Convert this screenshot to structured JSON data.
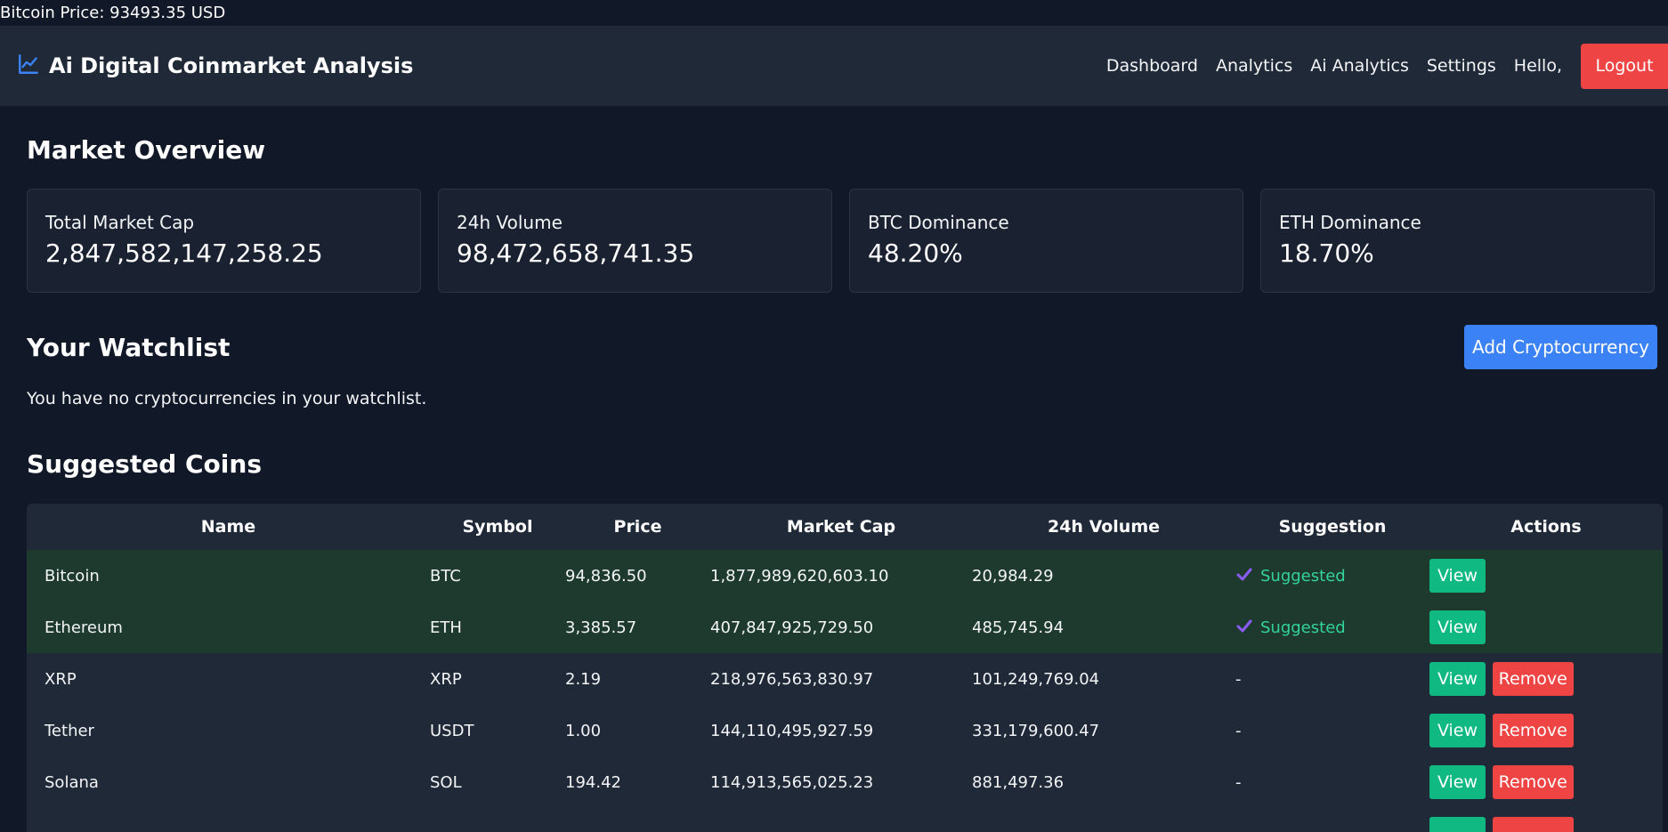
{
  "ticker": "Bitcoin Price: 93493.35 USD",
  "navbar": {
    "brand_icon": "chart-line-icon",
    "brand_title": "Ai Digital Coinmarket Analysis",
    "links": [
      "Dashboard",
      "Analytics",
      "Ai Analytics",
      "Settings"
    ],
    "greeting": "Hello,",
    "logout_label": "Logout"
  },
  "overview": {
    "title": "Market Overview",
    "cards": [
      {
        "label": "Total Market Cap",
        "value": "2,847,582,147,258.25"
      },
      {
        "label": "24h Volume",
        "value": "98,472,658,741.35"
      },
      {
        "label": "BTC Dominance",
        "value": "48.20%"
      },
      {
        "label": "ETH Dominance",
        "value": "18.70%"
      }
    ]
  },
  "watchlist": {
    "title": "Your Watchlist",
    "add_label": "Add Cryptocurrency",
    "empty_message": "You have no cryptocurrencies in your watchlist."
  },
  "suggested": {
    "title": "Suggested Coins",
    "columns": [
      "Name",
      "Symbol",
      "Price",
      "Market Cap",
      "24h Volume",
      "Suggestion",
      "Actions"
    ],
    "view_label": "View",
    "remove_label": "Remove",
    "suggested_label": "Suggested",
    "rows": [
      {
        "name": "Bitcoin",
        "symbol": "BTC",
        "price": "94,836.50",
        "market_cap": "1,877,989,620,603.10",
        "volume": "20,984.29",
        "suggestion": "Suggested"
      },
      {
        "name": "Ethereum",
        "symbol": "ETH",
        "price": "3,385.57",
        "market_cap": "407,847,925,729.50",
        "volume": "485,745.94",
        "suggestion": "Suggested"
      },
      {
        "name": "XRP",
        "symbol": "XRP",
        "price": "2.19",
        "market_cap": "218,976,563,830.97",
        "volume": "101,249,769.04",
        "suggestion": "-"
      },
      {
        "name": "Tether",
        "symbol": "USDT",
        "price": "1.00",
        "market_cap": "144,110,495,927.59",
        "volume": "331,179,600.47",
        "suggestion": "-"
      },
      {
        "name": "Solana",
        "symbol": "SOL",
        "price": "194.42",
        "market_cap": "114,913,565,025.23",
        "volume": "881,497.36",
        "suggestion": "-"
      }
    ]
  },
  "colors": {
    "background": "#111827",
    "navbar": "#1f2937",
    "logout": "#ef4444",
    "add_button": "#3b82f6",
    "view_button": "#10b981",
    "suggested_row": "#1e3a2f",
    "suggested_text": "#34d399"
  }
}
